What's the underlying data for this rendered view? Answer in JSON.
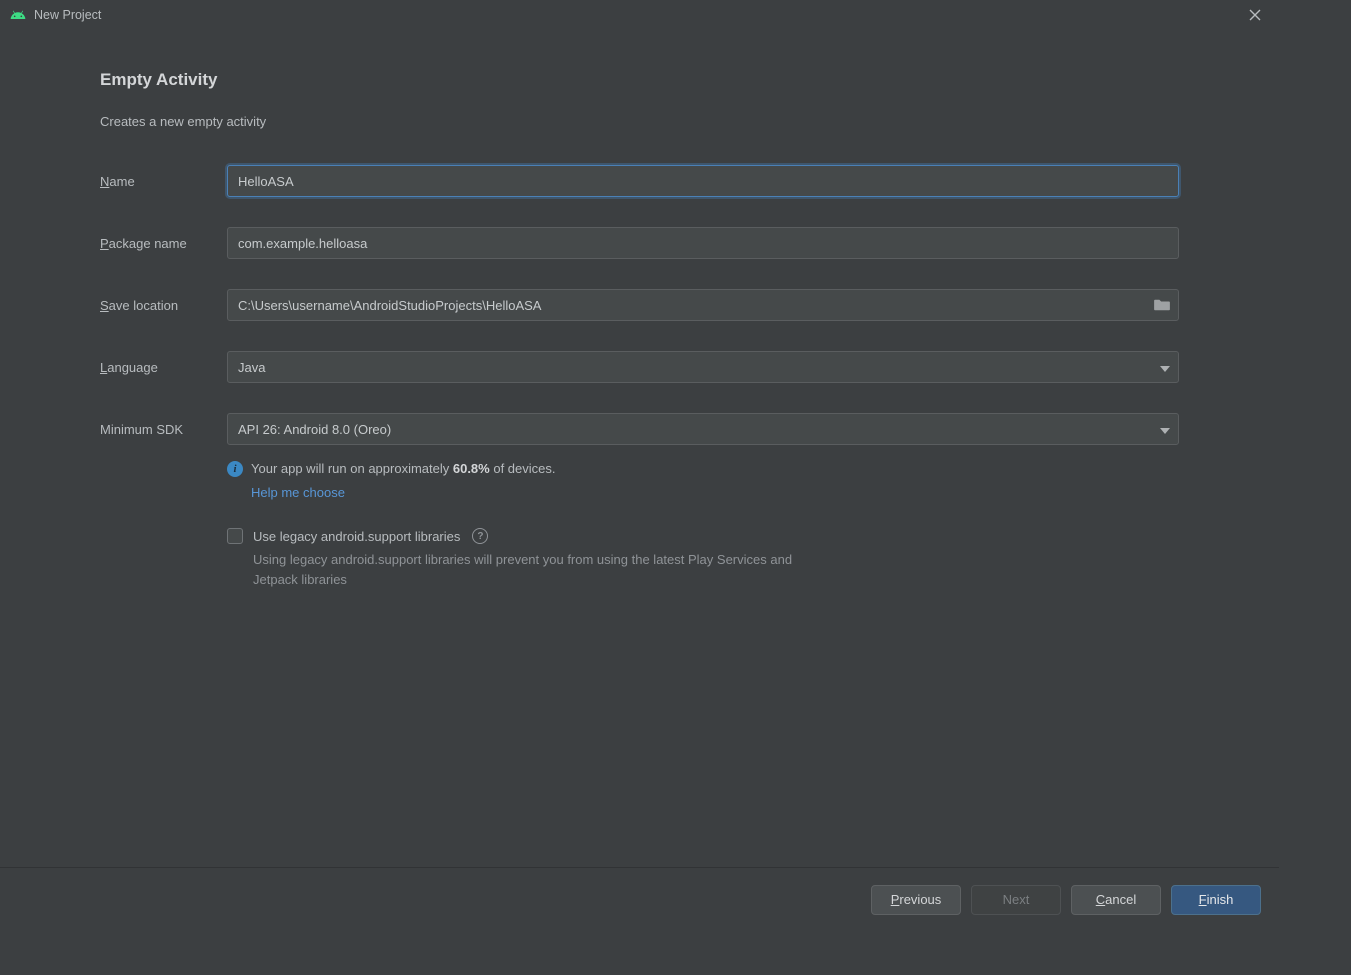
{
  "window": {
    "title": "New Project"
  },
  "page": {
    "heading": "Empty Activity",
    "subtitle": "Creates a new empty activity"
  },
  "labels": {
    "name_first": "N",
    "name_rest": "ame",
    "package_first": "P",
    "package_rest": "ackage name",
    "save_first": "S",
    "save_rest": "ave location",
    "language_first": "L",
    "language_rest": "anguage",
    "sdk": "Minimum SDK"
  },
  "fields": {
    "name": "HelloASA",
    "package": "com.example.helloasa",
    "save_location": "C:\\Users\\username\\AndroidStudioProjects\\HelloASA",
    "language": "Java",
    "min_sdk": "API 26: Android 8.0 (Oreo)"
  },
  "info": {
    "prefix": "Your app will run on approximately ",
    "percent": "60.8%",
    "suffix": " of devices.",
    "help": "Help me choose"
  },
  "legacy": {
    "label": "Use legacy android.support libraries",
    "desc": "Using legacy android.support libraries will prevent you from using the latest Play Services and Jetpack libraries"
  },
  "buttons": {
    "previous_u": "P",
    "previous_rest": "revious",
    "next": "Next",
    "cancel_u": "C",
    "cancel_rest": "ancel",
    "finish_u": "F",
    "finish_rest": "inish"
  }
}
